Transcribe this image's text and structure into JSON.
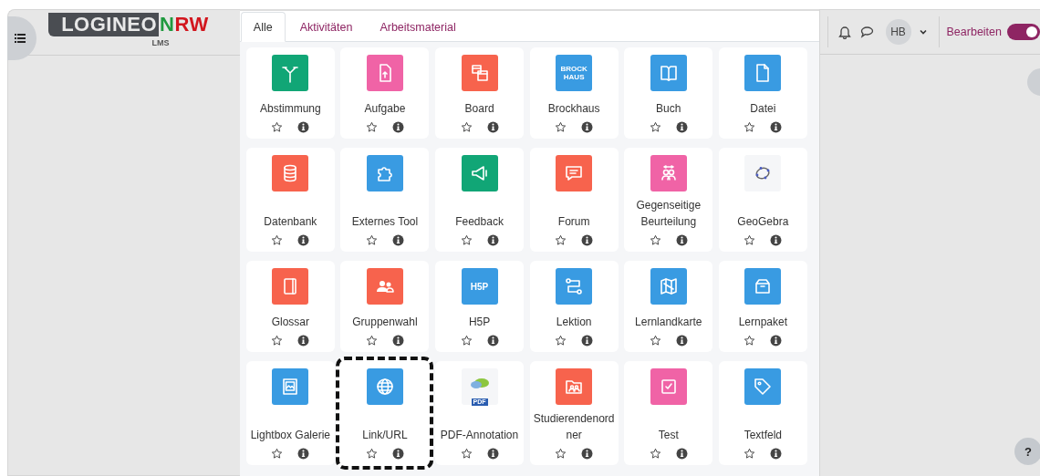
{
  "logo": {
    "word": "LOGINEO",
    "green": "N",
    "red": "RW",
    "sub": "LMS"
  },
  "header": {
    "avatar": "HB",
    "edit_label": "Bearbeiten",
    "edit_on": true
  },
  "tabs": [
    {
      "label": "Alle",
      "selected": true
    },
    {
      "label": "Aktivitäten",
      "selected": false
    },
    {
      "label": "Arbeitsmaterial",
      "selected": false
    }
  ],
  "modules": [
    {
      "name": "Abstimmung",
      "kind": "choice",
      "color": "#11a676",
      "starred": false,
      "highlighted": false
    },
    {
      "name": "Aufgabe",
      "kind": "upload",
      "color": "#f063a6",
      "starred": false,
      "highlighted": false
    },
    {
      "name": "Board",
      "kind": "board",
      "color": "#f7634d",
      "starred": false,
      "highlighted": false
    },
    {
      "name": "Brockhaus",
      "kind": "wordmark",
      "icon_text": "BROCK HAUS",
      "color": "#399be2",
      "starred": false,
      "highlighted": false
    },
    {
      "name": "Buch",
      "kind": "book",
      "color": "#399be2",
      "starred": false,
      "highlighted": false
    },
    {
      "name": "Datei",
      "kind": "file",
      "color": "#399be2",
      "starred": false,
      "highlighted": false
    },
    {
      "name": "Datenbank",
      "kind": "database",
      "color": "#f7634d",
      "starred": false,
      "highlighted": false
    },
    {
      "name": "Externes Tool",
      "kind": "puzzle",
      "color": "#399be2",
      "starred": false,
      "highlighted": false
    },
    {
      "name": "Feedback",
      "kind": "megaphone",
      "color": "#11a676",
      "starred": false,
      "highlighted": false
    },
    {
      "name": "Forum",
      "kind": "speech",
      "color": "#f7634d",
      "starred": false,
      "highlighted": false
    },
    {
      "name": "Gegenseitige Beurteilung",
      "kind": "people",
      "color": "#f063a6",
      "starred": false,
      "highlighted": false
    },
    {
      "name": "GeoGebra",
      "kind": "ring",
      "color": "#f5f6f8",
      "starred": false,
      "highlighted": false
    },
    {
      "name": "Glossar",
      "kind": "notebook",
      "color": "#f7634d",
      "starred": false,
      "highlighted": false
    },
    {
      "name": "Gruppenwahl",
      "kind": "group",
      "color": "#f7634d",
      "starred": false,
      "highlighted": false
    },
    {
      "name": "H5P",
      "kind": "wordmark",
      "icon_text": "H5P",
      "color": "#399be2",
      "starred": false,
      "highlighted": false
    },
    {
      "name": "Lektion",
      "kind": "flow",
      "color": "#399be2",
      "starred": false,
      "highlighted": false
    },
    {
      "name": "Lernlandkarte",
      "kind": "map",
      "color": "#399be2",
      "starred": false,
      "highlighted": false
    },
    {
      "name": "Lernpaket",
      "kind": "package",
      "color": "#399be2",
      "starred": false,
      "highlighted": false
    },
    {
      "name": "Lightbox Galerie",
      "kind": "image",
      "color": "#399be2",
      "starred": false,
      "highlighted": false
    },
    {
      "name": "Link/URL",
      "kind": "globe",
      "color": "#399be2",
      "starred": false,
      "highlighted": true
    },
    {
      "name": "PDF-Annotation",
      "kind": "pdf",
      "icon_text": "PDF",
      "color": "#f5f6f8",
      "starred": false,
      "highlighted": false
    },
    {
      "name": "Studierendenordner",
      "kind": "folder",
      "color": "#f7634d",
      "starred": false,
      "highlighted": false
    },
    {
      "name": "Test",
      "kind": "check",
      "color": "#f063a6",
      "starred": false,
      "highlighted": false
    },
    {
      "name": "Textfeld",
      "kind": "tag",
      "color": "#399be2",
      "starred": false,
      "highlighted": false
    }
  ],
  "help": {
    "label": "?"
  }
}
